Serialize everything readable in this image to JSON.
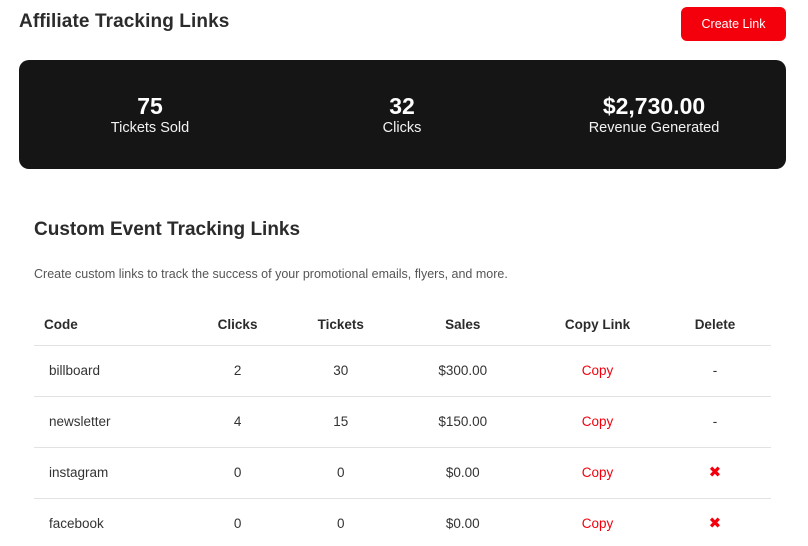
{
  "header": {
    "title": "Affiliate Tracking Links",
    "create_label": "Create Link"
  },
  "stats": [
    {
      "value": "75",
      "label": "Tickets Sold"
    },
    {
      "value": "32",
      "label": "Clicks"
    },
    {
      "value": "$2,730.00",
      "label": "Revenue Generated"
    }
  ],
  "section": {
    "title": "Custom Event Tracking Links",
    "description": "Create custom links to track the success of your promotional emails, flyers, and more."
  },
  "table": {
    "headers": [
      "Code",
      "Clicks",
      "Tickets",
      "Sales",
      "Copy Link",
      "Delete"
    ],
    "rows": [
      {
        "code": "billboard",
        "clicks": "2",
        "tickets": "30",
        "sales": "$300.00",
        "copy": "Copy",
        "delete": "-"
      },
      {
        "code": "newsletter",
        "clicks": "4",
        "tickets": "15",
        "sales": "$150.00",
        "copy": "Copy",
        "delete": "-"
      },
      {
        "code": "instagram",
        "clicks": "0",
        "tickets": "0",
        "sales": "$0.00",
        "copy": "Copy",
        "delete": "✖"
      },
      {
        "code": "facebook",
        "clicks": "0",
        "tickets": "0",
        "sales": "$0.00",
        "copy": "Copy",
        "delete": "✖"
      }
    ]
  },
  "colors": {
    "accent": "#f4000d",
    "stats_bg": "#151515"
  },
  "icons": {
    "delete": "close-x-icon"
  }
}
